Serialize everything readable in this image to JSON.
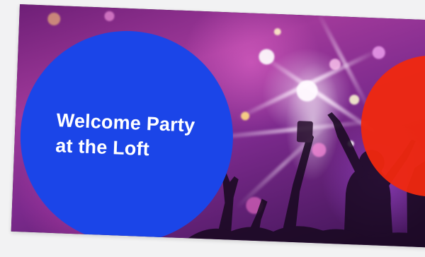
{
  "headline": {
    "line1": "Welcome Party",
    "line2": "at the Loft"
  },
  "colors": {
    "blue_circle": "#1b45e8",
    "red_circle": "#f0280f",
    "background": "#f2f2f3",
    "headline_text": "#ffffff"
  },
  "photo": {
    "subject": "concert-crowd-photo"
  }
}
